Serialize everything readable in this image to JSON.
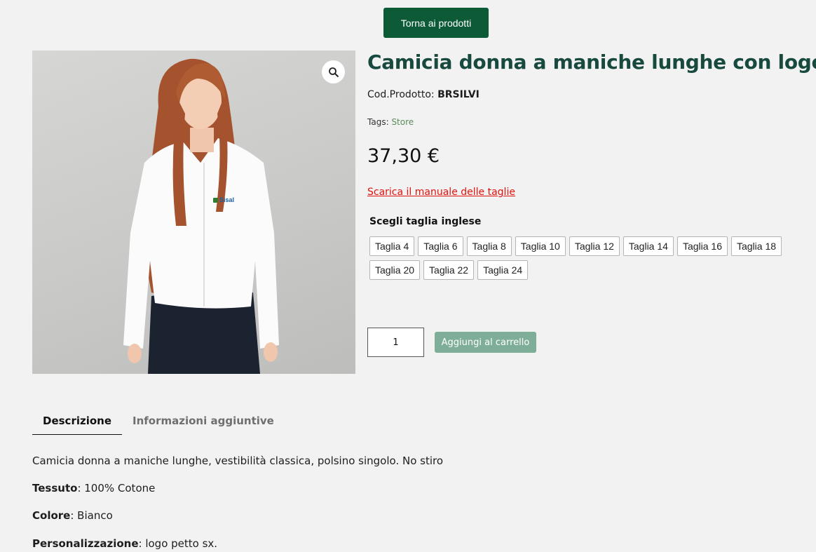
{
  "nav": {
    "back_label": "Torna ai prodotti"
  },
  "gallery": {
    "logo_text": "Sisal"
  },
  "product": {
    "title": "Camicia donna a maniche lunghe con logo",
    "sku_label": "Cod.Prodotto:",
    "sku_value": "BRSILVI",
    "tags_label": "Tags:",
    "tag": "Store",
    "price": "37,30 €",
    "size_guide": "Scarica il manuale delle taglie"
  },
  "sizes": {
    "label": "Scegli taglia inglese",
    "options": [
      "Taglia 4",
      "Taglia 6",
      "Taglia 8",
      "Taglia 10",
      "Taglia 12",
      "Taglia 14",
      "Taglia 16",
      "Taglia 18",
      "Taglia 20",
      "Taglia 22",
      "Taglia 24"
    ]
  },
  "cart": {
    "quantity": "1",
    "add_label": "Aggiungi al carrello"
  },
  "tabs": [
    {
      "label": "Descrizione"
    },
    {
      "label": "Informazioni aggiuntive"
    }
  ],
  "description": {
    "intro": "Camicia donna a maniche lunghe, vestibilità classica, polsino singolo. No stiro",
    "lines": [
      {
        "key": "Tessuto",
        "value": ": 100% Cotone"
      },
      {
        "key": "Colore",
        "value": ": Bianco"
      },
      {
        "key": "Personalizzazione",
        "value": ": logo petto sx."
      }
    ]
  },
  "colors": {
    "brand": "#0c5a36",
    "title": "#17493e",
    "link_red": "#e0120c",
    "tag_green": "#5a8c5a",
    "button_disabled": "#7fae98"
  }
}
